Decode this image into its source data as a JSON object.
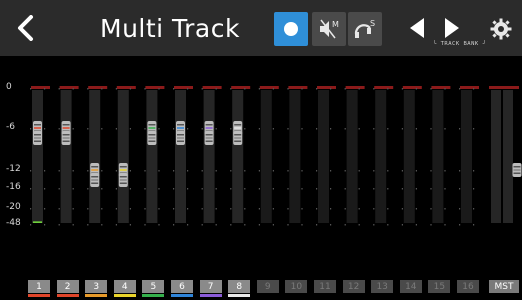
{
  "header": {
    "title": "Multi Track",
    "back_icon": "chevron-left-icon",
    "record_icon": "record-icon",
    "mute_icon": "mute-icon",
    "solo_icon": "solo-icon",
    "bank_prev_icon": "triangle-left-icon",
    "bank_next_icon": "triangle-right-icon",
    "bank_label": "TRACK BANK",
    "settings_icon": "gear-icon",
    "colors": {
      "record_active": "#2f8fd8",
      "muted_box": "#4a4a4a",
      "bar": "#2b2b2b"
    }
  },
  "scale": {
    "labels": [
      "0",
      "-6",
      "-12",
      "-16",
      "-20",
      "-48"
    ]
  },
  "tracks": [
    {
      "num": "1",
      "color": "#e0452a",
      "active": true,
      "level": 0.1,
      "fader_db": -6
    },
    {
      "num": "2",
      "color": "#e0452a",
      "active": true,
      "level": 0.0,
      "fader_db": -6
    },
    {
      "num": "3",
      "color": "#e79a2a",
      "active": true,
      "level": 0.0,
      "fader_db": -12
    },
    {
      "num": "4",
      "color": "#e8d32a",
      "active": true,
      "level": 0.0,
      "fader_db": -12
    },
    {
      "num": "5",
      "color": "#35b04c",
      "active": true,
      "level": 0.0,
      "fader_db": -6
    },
    {
      "num": "6",
      "color": "#2f84d8",
      "active": true,
      "level": 0.0,
      "fader_db": -6
    },
    {
      "num": "7",
      "color": "#8a5bd8",
      "active": true,
      "level": 0.0,
      "fader_db": -6
    },
    {
      "num": "8",
      "color": "#e8e8e8",
      "active": true,
      "level": 0.0,
      "fader_db": -6
    },
    {
      "num": "9",
      "active": false
    },
    {
      "num": "10",
      "active": false
    },
    {
      "num": "11",
      "active": false
    },
    {
      "num": "12",
      "active": false
    },
    {
      "num": "13",
      "active": false
    },
    {
      "num": "14",
      "active": false
    },
    {
      "num": "15",
      "active": false
    },
    {
      "num": "16",
      "active": false
    }
  ],
  "master": {
    "label": "MST",
    "fader_db": -12
  }
}
